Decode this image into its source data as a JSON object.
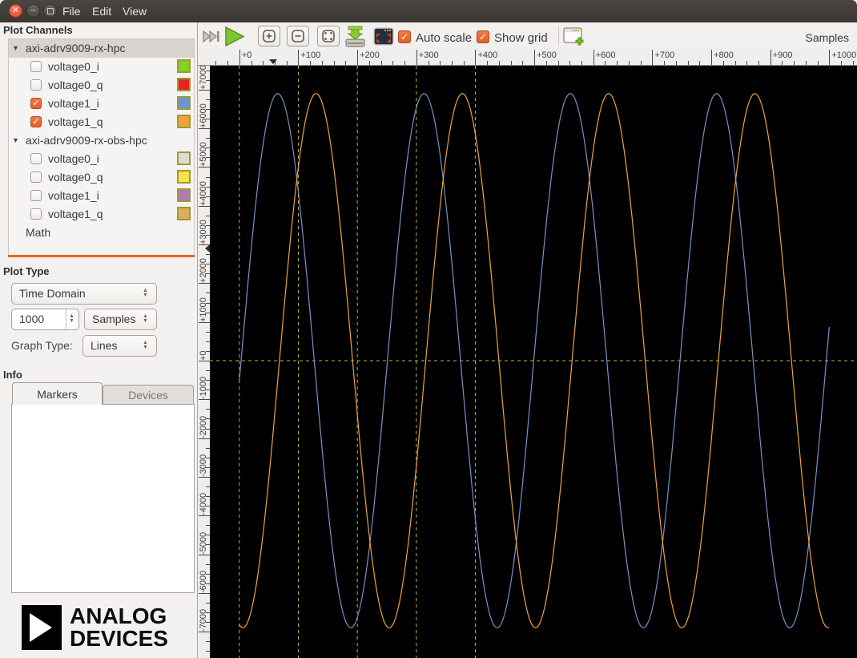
{
  "window": {
    "menus": [
      "File",
      "Edit",
      "View"
    ],
    "buttons": [
      "close",
      "minimize",
      "maximize"
    ]
  },
  "sidebar": {
    "plot_channels_title": "Plot Channels",
    "devices": [
      {
        "name": "axi-adrv9009-rx-hpc",
        "selected": true,
        "expanded": true,
        "channels": [
          {
            "label": "voltage0_i",
            "checked": false,
            "color": "#82d51f"
          },
          {
            "label": "voltage0_q",
            "checked": false,
            "color": "#e8231f"
          },
          {
            "label": "voltage1_i",
            "checked": true,
            "color": "#6c96cf"
          },
          {
            "label": "voltage1_q",
            "checked": true,
            "color": "#f0a23c"
          }
        ]
      },
      {
        "name": "axi-adrv9009-rx-obs-hpc",
        "selected": false,
        "expanded": true,
        "channels": [
          {
            "label": "voltage0_i",
            "checked": false,
            "color": "#dcdcd4"
          },
          {
            "label": "voltage0_q",
            "checked": false,
            "color": "#f4e44c"
          },
          {
            "label": "voltage1_i",
            "checked": false,
            "color": "#af7bb5"
          },
          {
            "label": "voltage1_q",
            "checked": false,
            "color": "#dfae5c"
          }
        ]
      }
    ],
    "math_label": "Math",
    "plot_type_title": "Plot Type",
    "plot_type_value": "Time Domain",
    "sample_count_value": "1000",
    "sample_unit_value": "Samples",
    "graph_type_label": "Graph Type:",
    "graph_type_value": "Lines",
    "info_title": "Info",
    "tabs": [
      {
        "label": "Markers",
        "active": true
      },
      {
        "label": "Devices",
        "active": false
      }
    ],
    "logo_line1": "ANALOG",
    "logo_line2": "DEVICES"
  },
  "toolbar": {
    "icons": [
      "skip-forward-icon",
      "play-icon",
      "zoom-in-button",
      "zoom-out-button",
      "zoom-fit-button",
      "save-capture-button",
      "fullscreen-button",
      "new-plot-button"
    ],
    "autoscale_label": "Auto scale",
    "autoscale_checked": true,
    "showgrid_label": "Show grid",
    "showgrid_checked": true,
    "check_glyph": "✓",
    "axis_unit_label": "Samples"
  },
  "chart_data": {
    "type": "line",
    "background": "#000000",
    "x_axis": {
      "unit": "Samples",
      "visible_min": -50,
      "visible_max": 1047,
      "minor_tick_step": 20,
      "major_ticks": [
        {
          "v": 0,
          "label": "+0"
        },
        {
          "v": 100,
          "label": "+100"
        },
        {
          "v": 200,
          "label": "+200"
        },
        {
          "v": 300,
          "label": "+300"
        },
        {
          "v": 400,
          "label": "+400"
        },
        {
          "v": 500,
          "label": "+500"
        },
        {
          "v": 600,
          "label": "+600"
        },
        {
          "v": 700,
          "label": "+700"
        },
        {
          "v": 800,
          "label": "+800"
        },
        {
          "v": 900,
          "label": "+900"
        },
        {
          "v": 1000,
          "label": "+1000"
        }
      ]
    },
    "y_axis": {
      "visible_min": -7681,
      "visible_max": 7619,
      "minor_tick_step": 250,
      "major_ticks": [
        {
          "v": 7000,
          "label": "+7000"
        },
        {
          "v": 6000,
          "label": "+6000"
        },
        {
          "v": 5000,
          "label": "+5000"
        },
        {
          "v": 4000,
          "label": "+4000"
        },
        {
          "v": 3000,
          "label": "+3000"
        },
        {
          "v": 2000,
          "label": "+2000"
        },
        {
          "v": 1000,
          "label": "+1000"
        },
        {
          "v": 0,
          "label": "+0"
        },
        {
          "v": -1000,
          "label": "-1000"
        },
        {
          "v": -2000,
          "label": "-2000"
        },
        {
          "v": -3000,
          "label": "-3000"
        },
        {
          "v": -4000,
          "label": "-4000"
        },
        {
          "v": -5000,
          "label": "-5000"
        },
        {
          "v": -6000,
          "label": "-6000"
        },
        {
          "v": -7000,
          "label": "-7000"
        }
      ]
    },
    "grid": {
      "show": true,
      "color": "#b9b93a",
      "dash": "4 4",
      "vertical_lines_samples": [
        0,
        100,
        200,
        300,
        400
      ],
      "horizontal_lines_values": [
        0
      ]
    },
    "ruler_markers": {
      "x_sample": 57,
      "y_value": 2900
    },
    "series": [
      {
        "name": "voltage1_i",
        "color": "#7295c7",
        "model": "sine",
        "amplitude": 6900,
        "period_samples": 248,
        "ascending_zero_sample": 3,
        "num_samples": 1000
      },
      {
        "name": "voltage1_q",
        "color": "#f3a33b",
        "model": "sine",
        "amplitude": 6900,
        "period_samples": 248,
        "ascending_zero_sample": 68,
        "num_samples": 1000
      }
    ]
  }
}
